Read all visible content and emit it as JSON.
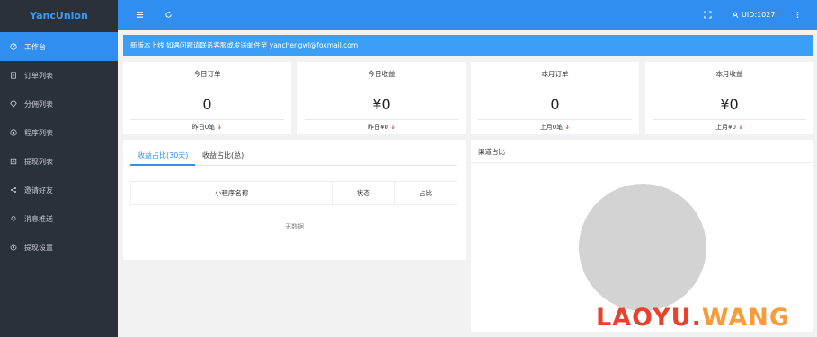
{
  "brand": "YancUnion",
  "sidebar": {
    "items": [
      {
        "label": "工作台",
        "icon": "dashboard-icon"
      },
      {
        "label": "订单列表",
        "icon": "list-icon"
      },
      {
        "label": "分佣列表",
        "icon": "diamond-icon"
      },
      {
        "label": "程序列表",
        "icon": "app-icon"
      },
      {
        "label": "提现列表",
        "icon": "withdraw-icon"
      },
      {
        "label": "邀请好友",
        "icon": "share-icon"
      },
      {
        "label": "消息推送",
        "icon": "bell-icon"
      },
      {
        "label": "提现设置",
        "icon": "settings-icon"
      }
    ]
  },
  "topbar": {
    "uid": "UID:1027"
  },
  "notice": {
    "text": "新版本上线 如遇问题请联系客服或发送邮件至 yanchengwl@foxmail.com"
  },
  "stats": [
    {
      "title": "今日订单",
      "value": "0",
      "foot": "昨日0笔",
      "arrow": "↓"
    },
    {
      "title": "今日收益",
      "value": "¥0",
      "foot": "昨日¥0",
      "arrow": "↓"
    },
    {
      "title": "本月订单",
      "value": "0",
      "foot": "上月0笔",
      "arrow": "↓"
    },
    {
      "title": "本月收益",
      "value": "¥0",
      "foot": "上月¥0",
      "arrow": "↓"
    }
  ],
  "left_panel": {
    "tabs": [
      "收益占比(30天)",
      "收益占比(总)"
    ],
    "columns": [
      "小程序名称",
      "状态",
      "占比"
    ],
    "empty": "无数据"
  },
  "right_panel": {
    "title": "渠道占比"
  },
  "watermark": {
    "a": "LAOYU",
    "dot": ".",
    "b": "WANG"
  },
  "colors": {
    "primary": "#2f8ef0",
    "sidebar": "#2b3139",
    "down": "#e6473a"
  }
}
